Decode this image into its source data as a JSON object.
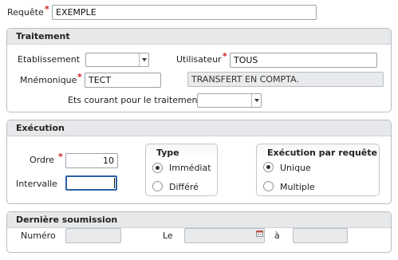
{
  "request": {
    "label": "Requête",
    "required_mark": "*",
    "value": "EXEMPLE"
  },
  "traitement": {
    "title": "Traitement",
    "etablissement_label": "Etablissement",
    "etablissement_value": "",
    "utilisateur_label": "Utilisateur",
    "utilisateur_required": "*",
    "utilisateur_value": "TOUS",
    "mnemonique_label": "Mnémonique",
    "mnemonique_required": "*",
    "mnemonique_value": "TECT",
    "mnemonique_description": "TRANSFERT EN COMPTA.",
    "ets_courant_label": "Ets courant pour le traitement",
    "ets_courant_value": ""
  },
  "execution": {
    "title": "Exécution",
    "ordre_label": "Ordre",
    "ordre_required": "*",
    "ordre_value": "10",
    "intervalle_label": "Intervalle",
    "intervalle_value": "",
    "type_group": {
      "title": "Type",
      "options": [
        "Immédiat",
        "Différé"
      ],
      "selected": "Immédiat"
    },
    "par_requete_group": {
      "title": "Exécution par requête",
      "options": [
        "Unique",
        "Multiple"
      ],
      "selected": "Unique"
    }
  },
  "derniere_soumission": {
    "title": "Dernière soumission",
    "numero_label": "Numéro",
    "numero_value": "",
    "le_label": "Le",
    "le_value": "",
    "a_label": "à",
    "a_value": ""
  },
  "icons": {
    "dropdown": "chevron-down-icon",
    "calendar": "calendar-icon"
  },
  "colors": {
    "required": "#d11a1a",
    "panel_header": "#e7e8ea",
    "focus_border": "#2c5fa6",
    "disabled_field": "#e9eaeb"
  }
}
